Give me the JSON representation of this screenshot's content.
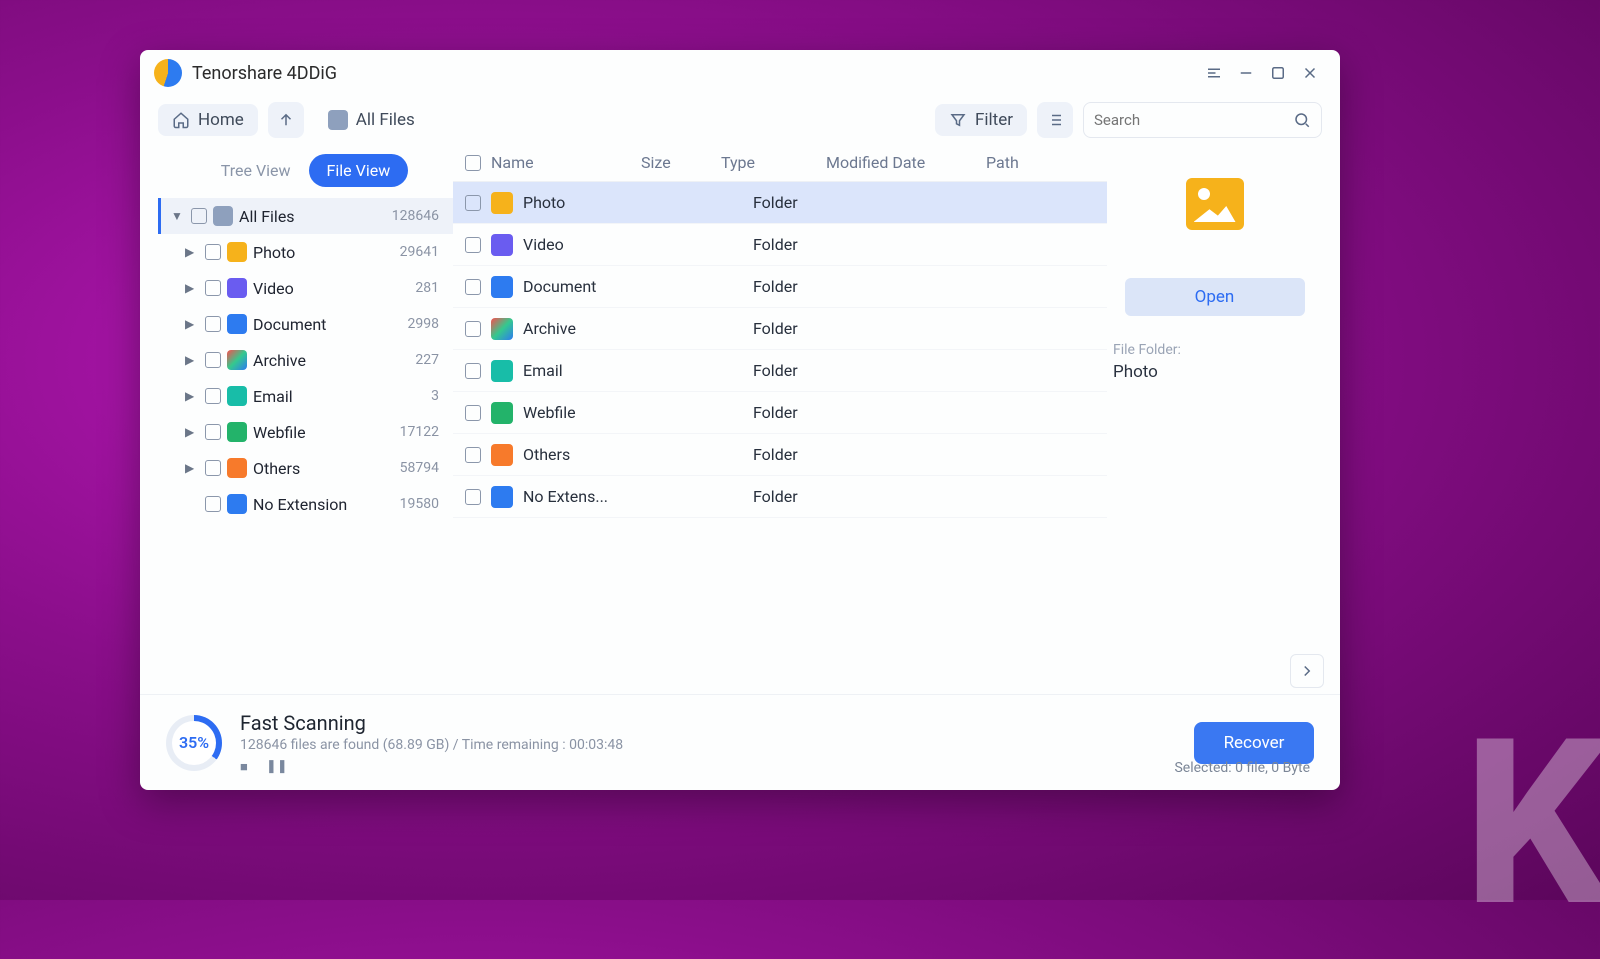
{
  "titlebar": {
    "app_name": "Tenorshare 4DDiG"
  },
  "toolbar": {
    "home_label": "Home",
    "breadcrumb": "All Files",
    "filter_label": "Filter",
    "search_placeholder": "Search"
  },
  "viewtabs": {
    "tree": "Tree View",
    "file": "File View",
    "active": "file"
  },
  "tree": {
    "root": {
      "label": "All Files",
      "count": "128646"
    },
    "children": [
      {
        "key": "photo",
        "label": "Photo",
        "count": "29641",
        "icon": "ic-photo"
      },
      {
        "key": "video",
        "label": "Video",
        "count": "281",
        "icon": "ic-video"
      },
      {
        "key": "document",
        "label": "Document",
        "count": "2998",
        "icon": "ic-doc"
      },
      {
        "key": "archive",
        "label": "Archive",
        "count": "227",
        "icon": "ic-archive"
      },
      {
        "key": "email",
        "label": "Email",
        "count": "3",
        "icon": "ic-email"
      },
      {
        "key": "webfile",
        "label": "Webfile",
        "count": "17122",
        "icon": "ic-web"
      },
      {
        "key": "others",
        "label": "Others",
        "count": "58794",
        "icon": "ic-others"
      },
      {
        "key": "noext",
        "label": "No Extension",
        "count": "19580",
        "icon": "ic-noext",
        "leaf": true
      }
    ]
  },
  "columns": {
    "name": "Name",
    "size": "Size",
    "type": "Type",
    "modified": "Modified Date",
    "path": "Path"
  },
  "rows": [
    {
      "name": "Photo",
      "type": "Folder",
      "icon": "ic-photo",
      "selected": true
    },
    {
      "name": "Video",
      "type": "Folder",
      "icon": "ic-video"
    },
    {
      "name": "Document",
      "type": "Folder",
      "icon": "ic-doc"
    },
    {
      "name": "Archive",
      "type": "Folder",
      "icon": "ic-archive"
    },
    {
      "name": "Email",
      "type": "Folder",
      "icon": "ic-email"
    },
    {
      "name": "Webfile",
      "type": "Folder",
      "icon": "ic-web"
    },
    {
      "name": "Others",
      "type": "Folder",
      "icon": "ic-others"
    },
    {
      "name": "No Extens...",
      "type": "Folder",
      "icon": "ic-noext"
    }
  ],
  "preview": {
    "open_label": "Open",
    "meta_key": "File Folder:",
    "meta_val": "Photo"
  },
  "footer": {
    "percent": "35%",
    "title": "Fast Scanning",
    "subtitle": "128646 files are found (68.89 GB) /  Time remaining : 00:03:48",
    "recover": "Recover",
    "selected": "Selected: 0 file, 0 Byte"
  }
}
